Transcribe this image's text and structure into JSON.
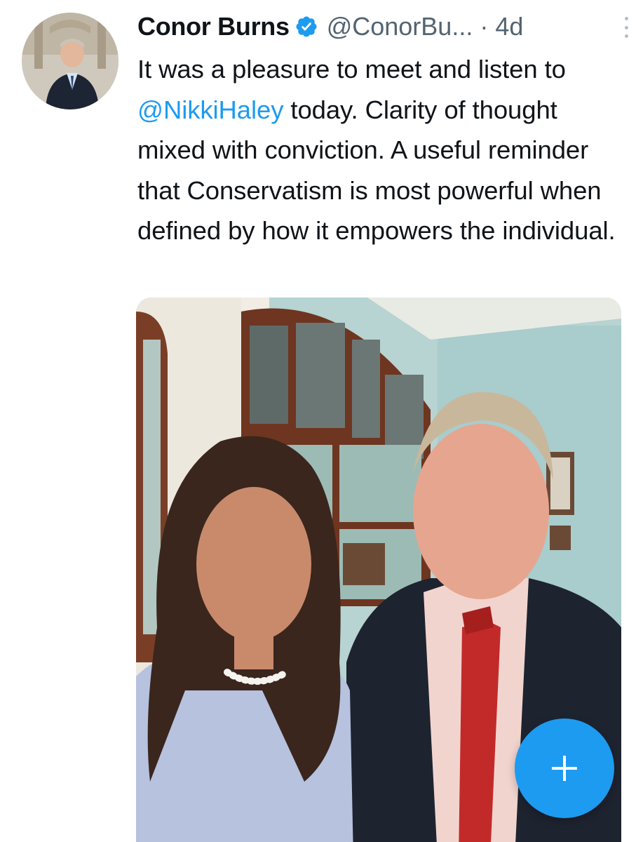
{
  "tweet": {
    "author_name": "Conor Burns",
    "handle": "@ConorBu...",
    "separator": "·",
    "time": "4d",
    "text_before": "It was a pleasure to meet and listen to ",
    "mention": "@NikkiHaley",
    "text_after": " today. Clarity of thought mixed with conviction. A useful reminder that Conservatism is most powerful when defined by how it empowers the individual."
  },
  "icons": {
    "verified": "verified-badge-icon",
    "more": "more-vertical-icon",
    "compose": "plus-icon"
  },
  "colors": {
    "accent": "#1d9bf0",
    "secondary_text": "#536471",
    "primary_text": "#0f1419"
  }
}
